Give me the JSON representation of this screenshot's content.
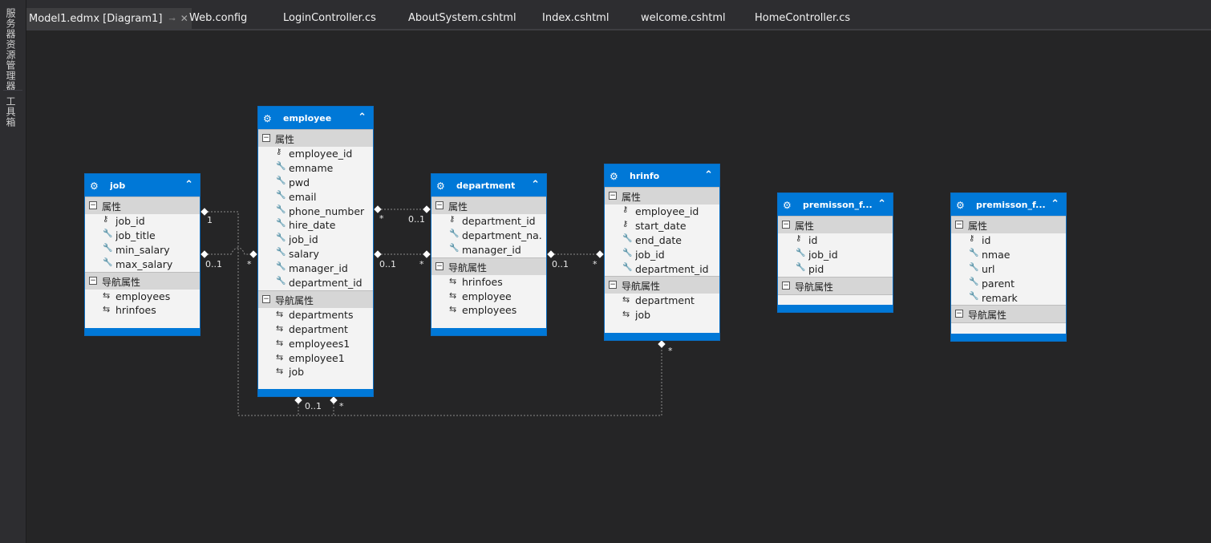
{
  "sidebar": {
    "tab1": "服务器资源管理器",
    "tab2": "工具箱"
  },
  "tabs": [
    {
      "label": "Model1.edmx [Diagram1]",
      "pin": "⊸",
      "close": "✕"
    },
    {
      "label": "Web.config"
    },
    {
      "label": "LoginController.cs"
    },
    {
      "label": "AboutSystem.cshtml"
    },
    {
      "label": "Index.cshtml"
    },
    {
      "label": "welcome.cshtml"
    },
    {
      "label": "HomeController.cs"
    }
  ],
  "section_labels": {
    "props": "属性",
    "nav": "导航属性"
  },
  "entities": {
    "job": {
      "name": "job",
      "props": [
        {
          "icon": "key",
          "name": "job_id"
        },
        {
          "icon": "wrench",
          "name": "job_title"
        },
        {
          "icon": "wrench",
          "name": "min_salary"
        },
        {
          "icon": "wrench",
          "name": "max_salary"
        }
      ],
      "nav": [
        "employees",
        "hrinfoes"
      ]
    },
    "employee": {
      "name": "employee",
      "props": [
        {
          "icon": "key",
          "name": "employee_id"
        },
        {
          "icon": "wrench",
          "name": "emname"
        },
        {
          "icon": "wrench",
          "name": "pwd"
        },
        {
          "icon": "wrench",
          "name": "email"
        },
        {
          "icon": "wrench",
          "name": "phone_number"
        },
        {
          "icon": "wrench",
          "name": "hire_date"
        },
        {
          "icon": "wrench",
          "name": "job_id"
        },
        {
          "icon": "wrench",
          "name": "salary"
        },
        {
          "icon": "wrench",
          "name": "manager_id"
        },
        {
          "icon": "wrench",
          "name": "department_id"
        }
      ],
      "nav": [
        "departments",
        "department",
        "employees1",
        "employee1",
        "job"
      ]
    },
    "department": {
      "name": "department",
      "props": [
        {
          "icon": "key",
          "name": "department_id"
        },
        {
          "icon": "wrench",
          "name": "department_na..."
        },
        {
          "icon": "wrench",
          "name": "manager_id"
        }
      ],
      "nav": [
        "hrinfoes",
        "employee",
        "employees"
      ]
    },
    "hrinfo": {
      "name": "hrinfo",
      "props": [
        {
          "icon": "key",
          "name": "employee_id"
        },
        {
          "icon": "key",
          "name": "start_date"
        },
        {
          "icon": "wrench",
          "name": "end_date"
        },
        {
          "icon": "wrench",
          "name": "job_id"
        },
        {
          "icon": "wrench",
          "name": "department_id"
        }
      ],
      "nav": [
        "department",
        "job"
      ]
    },
    "premisson1": {
      "name": "premisson_f...",
      "props": [
        {
          "icon": "key",
          "name": "id"
        },
        {
          "icon": "wrench",
          "name": "job_id"
        },
        {
          "icon": "wrench",
          "name": "pid"
        }
      ],
      "nav": []
    },
    "premisson2": {
      "name": "premisson_f...",
      "props": [
        {
          "icon": "key",
          "name": "id"
        },
        {
          "icon": "wrench",
          "name": "nmae"
        },
        {
          "icon": "wrench",
          "name": "url"
        },
        {
          "icon": "wrench",
          "name": "parent"
        },
        {
          "icon": "wrench",
          "name": "remark"
        }
      ],
      "nav": []
    }
  },
  "multiplicities": {
    "m1": "1",
    "m2": "0..1",
    "m3": "*",
    "m4": "*",
    "m5": "0..1",
    "m6": "0..1",
    "m7": "*",
    "m8": "0..1",
    "m9": "*",
    "m10": "*",
    "m11": "0..1",
    "m12": "*"
  },
  "colors": {
    "header": "#0078d7",
    "canvas": "#252526",
    "chrome": "#2d2d30"
  }
}
